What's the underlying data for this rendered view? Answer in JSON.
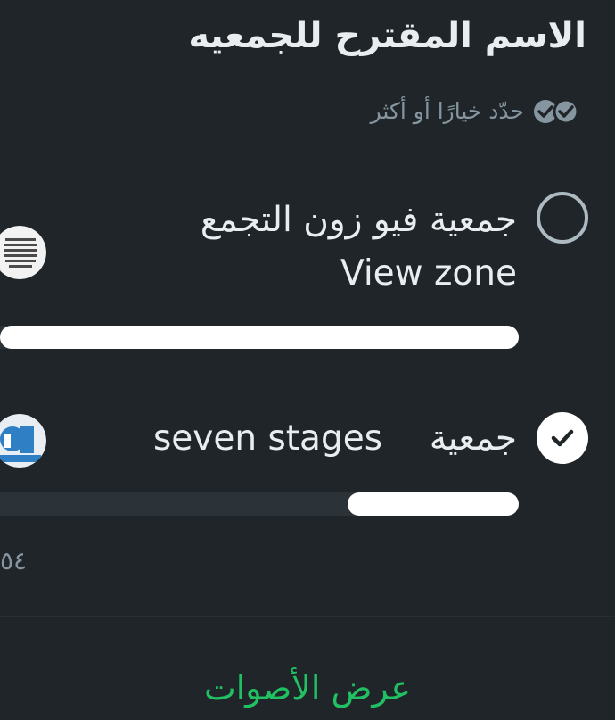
{
  "poll": {
    "title": "الاسم المقترح للجمعيه",
    "subtitle": "حدّد خيارًا أو أكثر",
    "options": [
      {
        "line1": "جمعية فيو زون التجمع",
        "line2": "View zone",
        "selected": false,
        "vote_fraction": 1.0
      },
      {
        "prefix": "جمعية",
        "name": "seven stages",
        "selected": true,
        "vote_fraction": 0.33
      }
    ],
    "total_count": "٥٤",
    "view_votes": "عرض الأصوات"
  },
  "colors": {
    "background": "#1f2528",
    "accent": "#21c063",
    "bar_fill": "#ffffff",
    "bar_track": "#2b3338",
    "muted_text": "#8696a0"
  },
  "icons": {
    "subtitle": "double-check-icon",
    "option1": "radio-unchecked-icon",
    "option2": "radio-checked-icon"
  }
}
